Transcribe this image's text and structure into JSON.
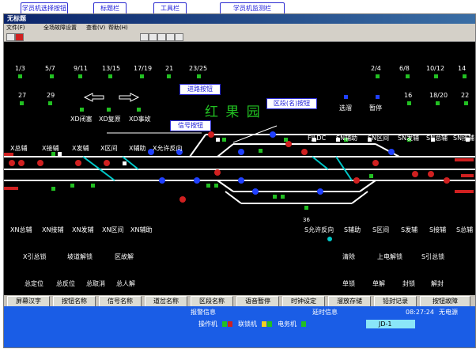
{
  "window": {
    "title": "无标题"
  },
  "menu": {
    "file": "文件(F)",
    "global": "全场故障设置",
    "view": "查看(V)",
    "help": "帮助(H)"
  },
  "annotations": {
    "station_select": "学员机选择按钮",
    "title_bar": "标题栏",
    "toolbar": "工具栏",
    "monitor_bar": "学员机监测栏",
    "route_button": "进路按钮",
    "section_button": "区段(名)按钮",
    "signal_button": "信号按钮"
  },
  "station": {
    "name": "红 果 园"
  },
  "top_numbers_left": [
    "1/3",
    "5/7",
    "9/11",
    "13/15",
    "17/19",
    "21",
    "23/25"
  ],
  "top_numbers_right": [
    "2/4",
    "6/8",
    "10/12",
    "14"
  ],
  "row2_left": [
    "27",
    "29"
  ],
  "row2_right": [
    "16",
    "18/20",
    "22"
  ],
  "upper_labels": {
    "xd_close": "XD闭塞",
    "xd_restore": "XD复原",
    "xd_accident": "XD事故",
    "select": "选溜",
    "pause": "暂停",
    "fjldc": "FJLDC",
    "sn_aux": "SN辅助",
    "sn_section": "SN区间",
    "sn_send": "SN发辅",
    "sn_total": "SN总辅",
    "sn_recv": "SN接辅"
  },
  "left_labels": {
    "x_total": "X总辅",
    "x_recv": "X接辅",
    "x_send": "X发辅",
    "x_section": "X区间",
    "x_aux": "X辅助",
    "x_allow_rev": "X允许反向"
  },
  "lower_labels": {
    "xn_total": "XN总辅",
    "xn_recv": "XN接辅",
    "xn_send": "XN发辅",
    "xn_section": "XN区间",
    "xn_aux": "XN辅助",
    "s_allow_rev": "S允许反向",
    "s_aux": "S辅助",
    "s_section": "S区间",
    "s_send": "S发辅",
    "s_recv": "S接辅",
    "s_total": "S总辅"
  },
  "misc_labels": {
    "x_guide_lock": "X引总锁",
    "slope_unlock": "坡道解锁",
    "section_fault": "区故解",
    "clear": "清除",
    "up_unlock": "上电解锁",
    "s_guide_lock": "S引总锁",
    "total_pos": "总定位",
    "total_rev": "总反位",
    "total_cancel": "总取消",
    "total_man": "总人解",
    "single_op": "单锁",
    "single_unlock": "单解",
    "seal": "封锁",
    "unseal": "解封",
    "sig_num": "36"
  },
  "bottom_buttons": [
    "屏幕汉字",
    "按钮名称",
    "信号名称",
    "道岔名称",
    "区段名称",
    "语音暂停",
    "时钟设定",
    "溜放存储",
    "铅封记录",
    "按钮故障"
  ],
  "status": {
    "alarm": "报警信息",
    "delay": "延时信息",
    "operator": "操作机",
    "interlock": "联锁机",
    "electric": "电务机",
    "time": "08:27:24",
    "power": "无电源",
    "jd": "JD-1"
  },
  "colors": {
    "green": "#22c022",
    "red": "#d02020",
    "blue": "#2040ff",
    "white": "#ffffff",
    "cyan": "#00c8c8",
    "yellow": "#f0d020",
    "status_blue": "#1a5de6"
  }
}
